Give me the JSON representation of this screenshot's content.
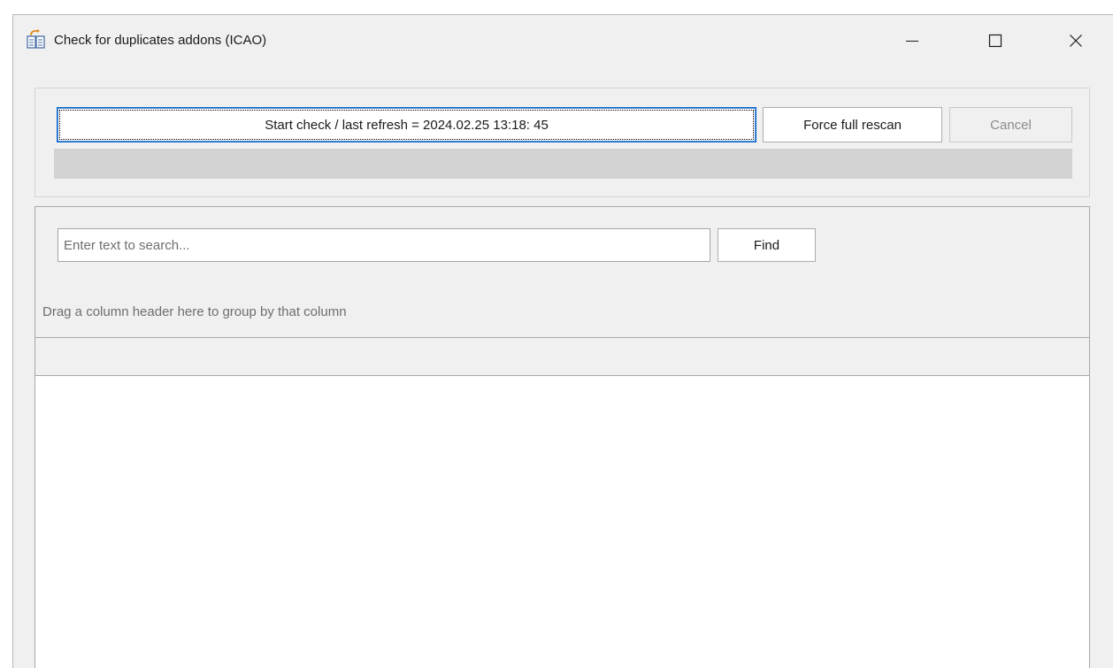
{
  "window": {
    "title": "Check for duplicates addons (ICAO)",
    "app_icon": "duplicate-files-icon",
    "controls": {
      "minimize_icon": "minimize-icon",
      "maximize_icon": "maximize-icon",
      "close_icon": "close-icon"
    }
  },
  "toolbar": {
    "start_check_label": "Start check / last refresh = 2024.02.25 13:18: 45",
    "force_rescan_label": "Force full rescan",
    "cancel_label": "Cancel",
    "cancel_enabled": false,
    "progress": 0
  },
  "find_panel": {
    "search_placeholder": "Enter text to search...",
    "search_value": "",
    "find_label": "Find"
  },
  "grid": {
    "group_panel_text": "Drag a column header here to group by that column",
    "columns": [],
    "rows": []
  },
  "colors": {
    "window_bg": "#f0f0f0",
    "focus_border": "#0066cc",
    "progress_track": "#d2d2d2",
    "disabled_text": "#8c8c8c",
    "hint_text": "#6e6e6e"
  }
}
